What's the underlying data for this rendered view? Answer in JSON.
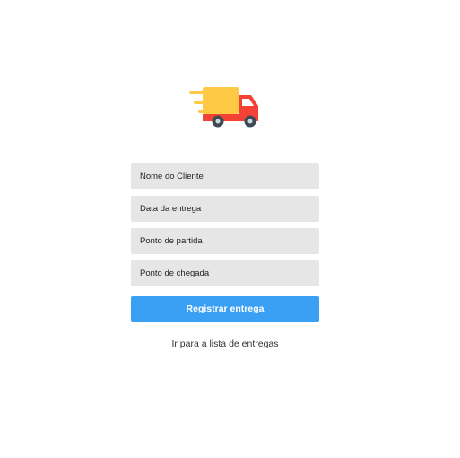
{
  "logo": {
    "icon": "delivery-truck-icon"
  },
  "form": {
    "fields": [
      {
        "placeholder": "Nome do Cliente",
        "value": ""
      },
      {
        "placeholder": "Data da entrega",
        "value": ""
      },
      {
        "placeholder": "Ponto de partida",
        "value": ""
      },
      {
        "placeholder": "Ponto de chegada",
        "value": ""
      }
    ],
    "submit_label": "Registrar entrega"
  },
  "link": {
    "text": "Ir para a lista de entregas"
  },
  "colors": {
    "button": "#3aa0f4",
    "input_bg": "#e6e6e6",
    "truck_cargo": "#ffc845",
    "truck_body": "#f44336",
    "wheel": "#3c4a55"
  }
}
